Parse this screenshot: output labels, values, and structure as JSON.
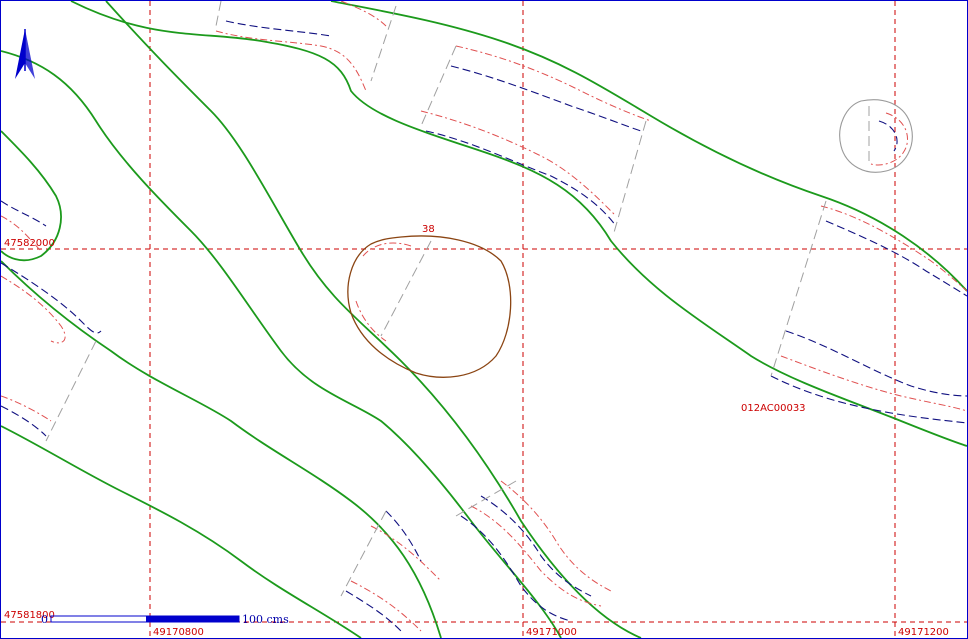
{
  "map": {
    "labels": {
      "y_upper": "47582000",
      "y_lower": "47581800",
      "x_left": "49170800",
      "x_mid": "49171000",
      "x_right": "49171200",
      "feature_number": "38",
      "feature_code": "012AC00033"
    },
    "scale_bar": {
      "zero": "0",
      "length_text": "100 cms"
    },
    "north_arrow": {
      "icon": "north-arrow-icon"
    },
    "colors": {
      "grid": "#cc0000",
      "road": "#1c9a1c",
      "contour_red": "#e05050",
      "contour_blue": "#101080",
      "pit": "#8b4513",
      "scale_bar": "#0000cc"
    }
  }
}
